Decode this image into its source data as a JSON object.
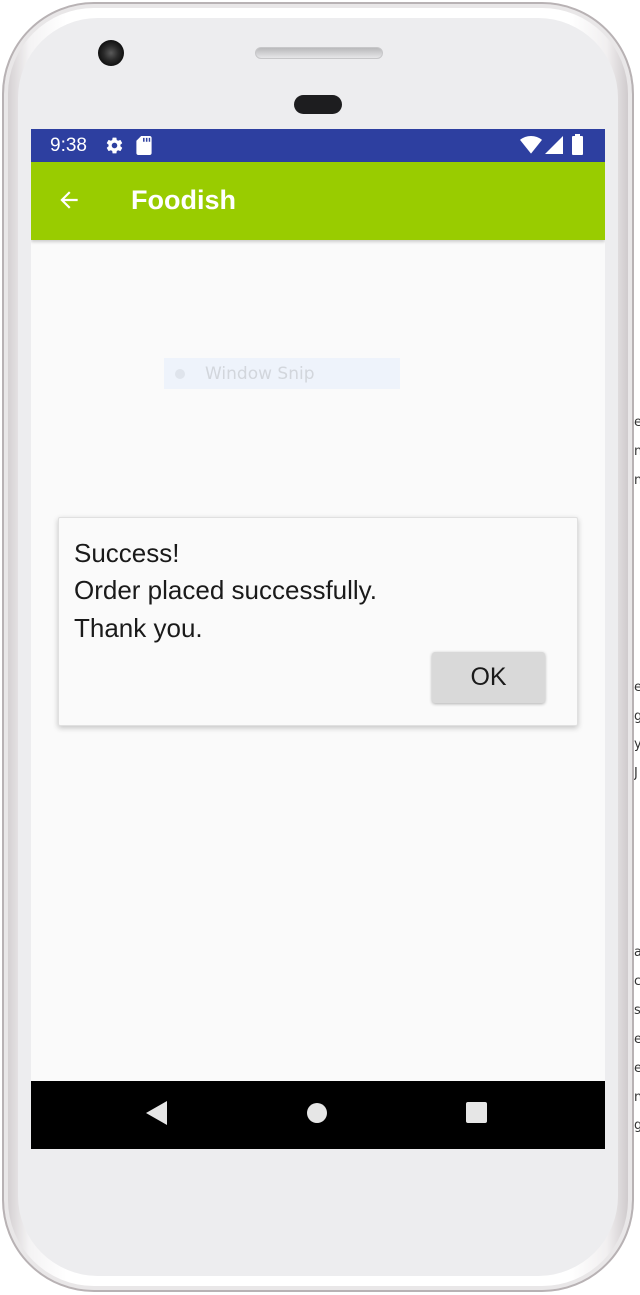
{
  "status_bar": {
    "time": "9:38",
    "icons": [
      "settings-gear-icon",
      "sd-card-icon",
      "wifi-icon",
      "signal-icon",
      "battery-icon"
    ]
  },
  "app_bar": {
    "title": "Foodish",
    "back_icon": "arrow-back-icon",
    "color": "#99cc00"
  },
  "overlay": {
    "window_snip_label": "Window Snip"
  },
  "dialog": {
    "lines": [
      "Success!",
      "Order placed successfully.",
      "Thank you."
    ],
    "ok_label": "OK"
  },
  "nav_bar": {
    "buttons": [
      "back-triangle-icon",
      "home-circle-icon",
      "recents-square-icon"
    ]
  },
  "background_edge_letters": [
    "e",
    "n",
    "n",
    "e",
    "g",
    "y",
    "J",
    "a",
    "c",
    "s",
    "e",
    "e",
    "n",
    "g"
  ],
  "colors": {
    "status_bar": "#2d3fa0",
    "screen_background": "#fafafa",
    "nav_bar": "#000000",
    "ok_button": "#d9d9d9"
  }
}
